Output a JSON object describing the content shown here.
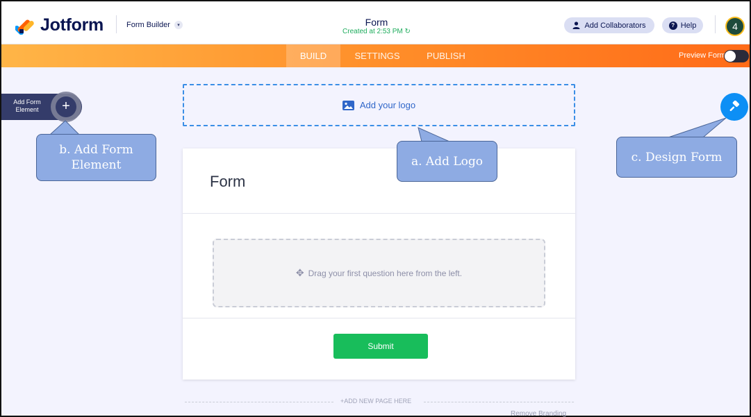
{
  "header": {
    "brand": "Jotform",
    "builder_select": "Form Builder",
    "form_title": "Form",
    "created": "Created at 2:53 PM",
    "collaborators_label": "Add Collaborators",
    "help_label": "Help",
    "avatar_badge": "4"
  },
  "nav": {
    "tabs": [
      {
        "label": "BUILD",
        "active": true
      },
      {
        "label": "SETTINGS",
        "active": false
      },
      {
        "label": "PUBLISH",
        "active": false
      }
    ],
    "preview_label": "Preview Form"
  },
  "left_panel": {
    "add_element_label": "Add Form Element",
    "plus": "+"
  },
  "logo_area": {
    "label": "Add your logo"
  },
  "form_card": {
    "title": "Form",
    "drop_hint": "Drag your first question here from the left.",
    "submit_label": "Submit"
  },
  "footer": {
    "add_page": "+ADD NEW PAGE HERE",
    "remove_branding": "Remove Branding"
  },
  "callouts": {
    "a": "a. Add Logo",
    "b": "b. Add Form Element",
    "c": "c. Design Form"
  },
  "colors": {
    "brand_navy": "#0a1551",
    "accent_orange": "#ff6b18",
    "submit_green": "#18bd5b",
    "design_blue": "#0d8ff5",
    "callout_fill": "#8eabe3"
  }
}
